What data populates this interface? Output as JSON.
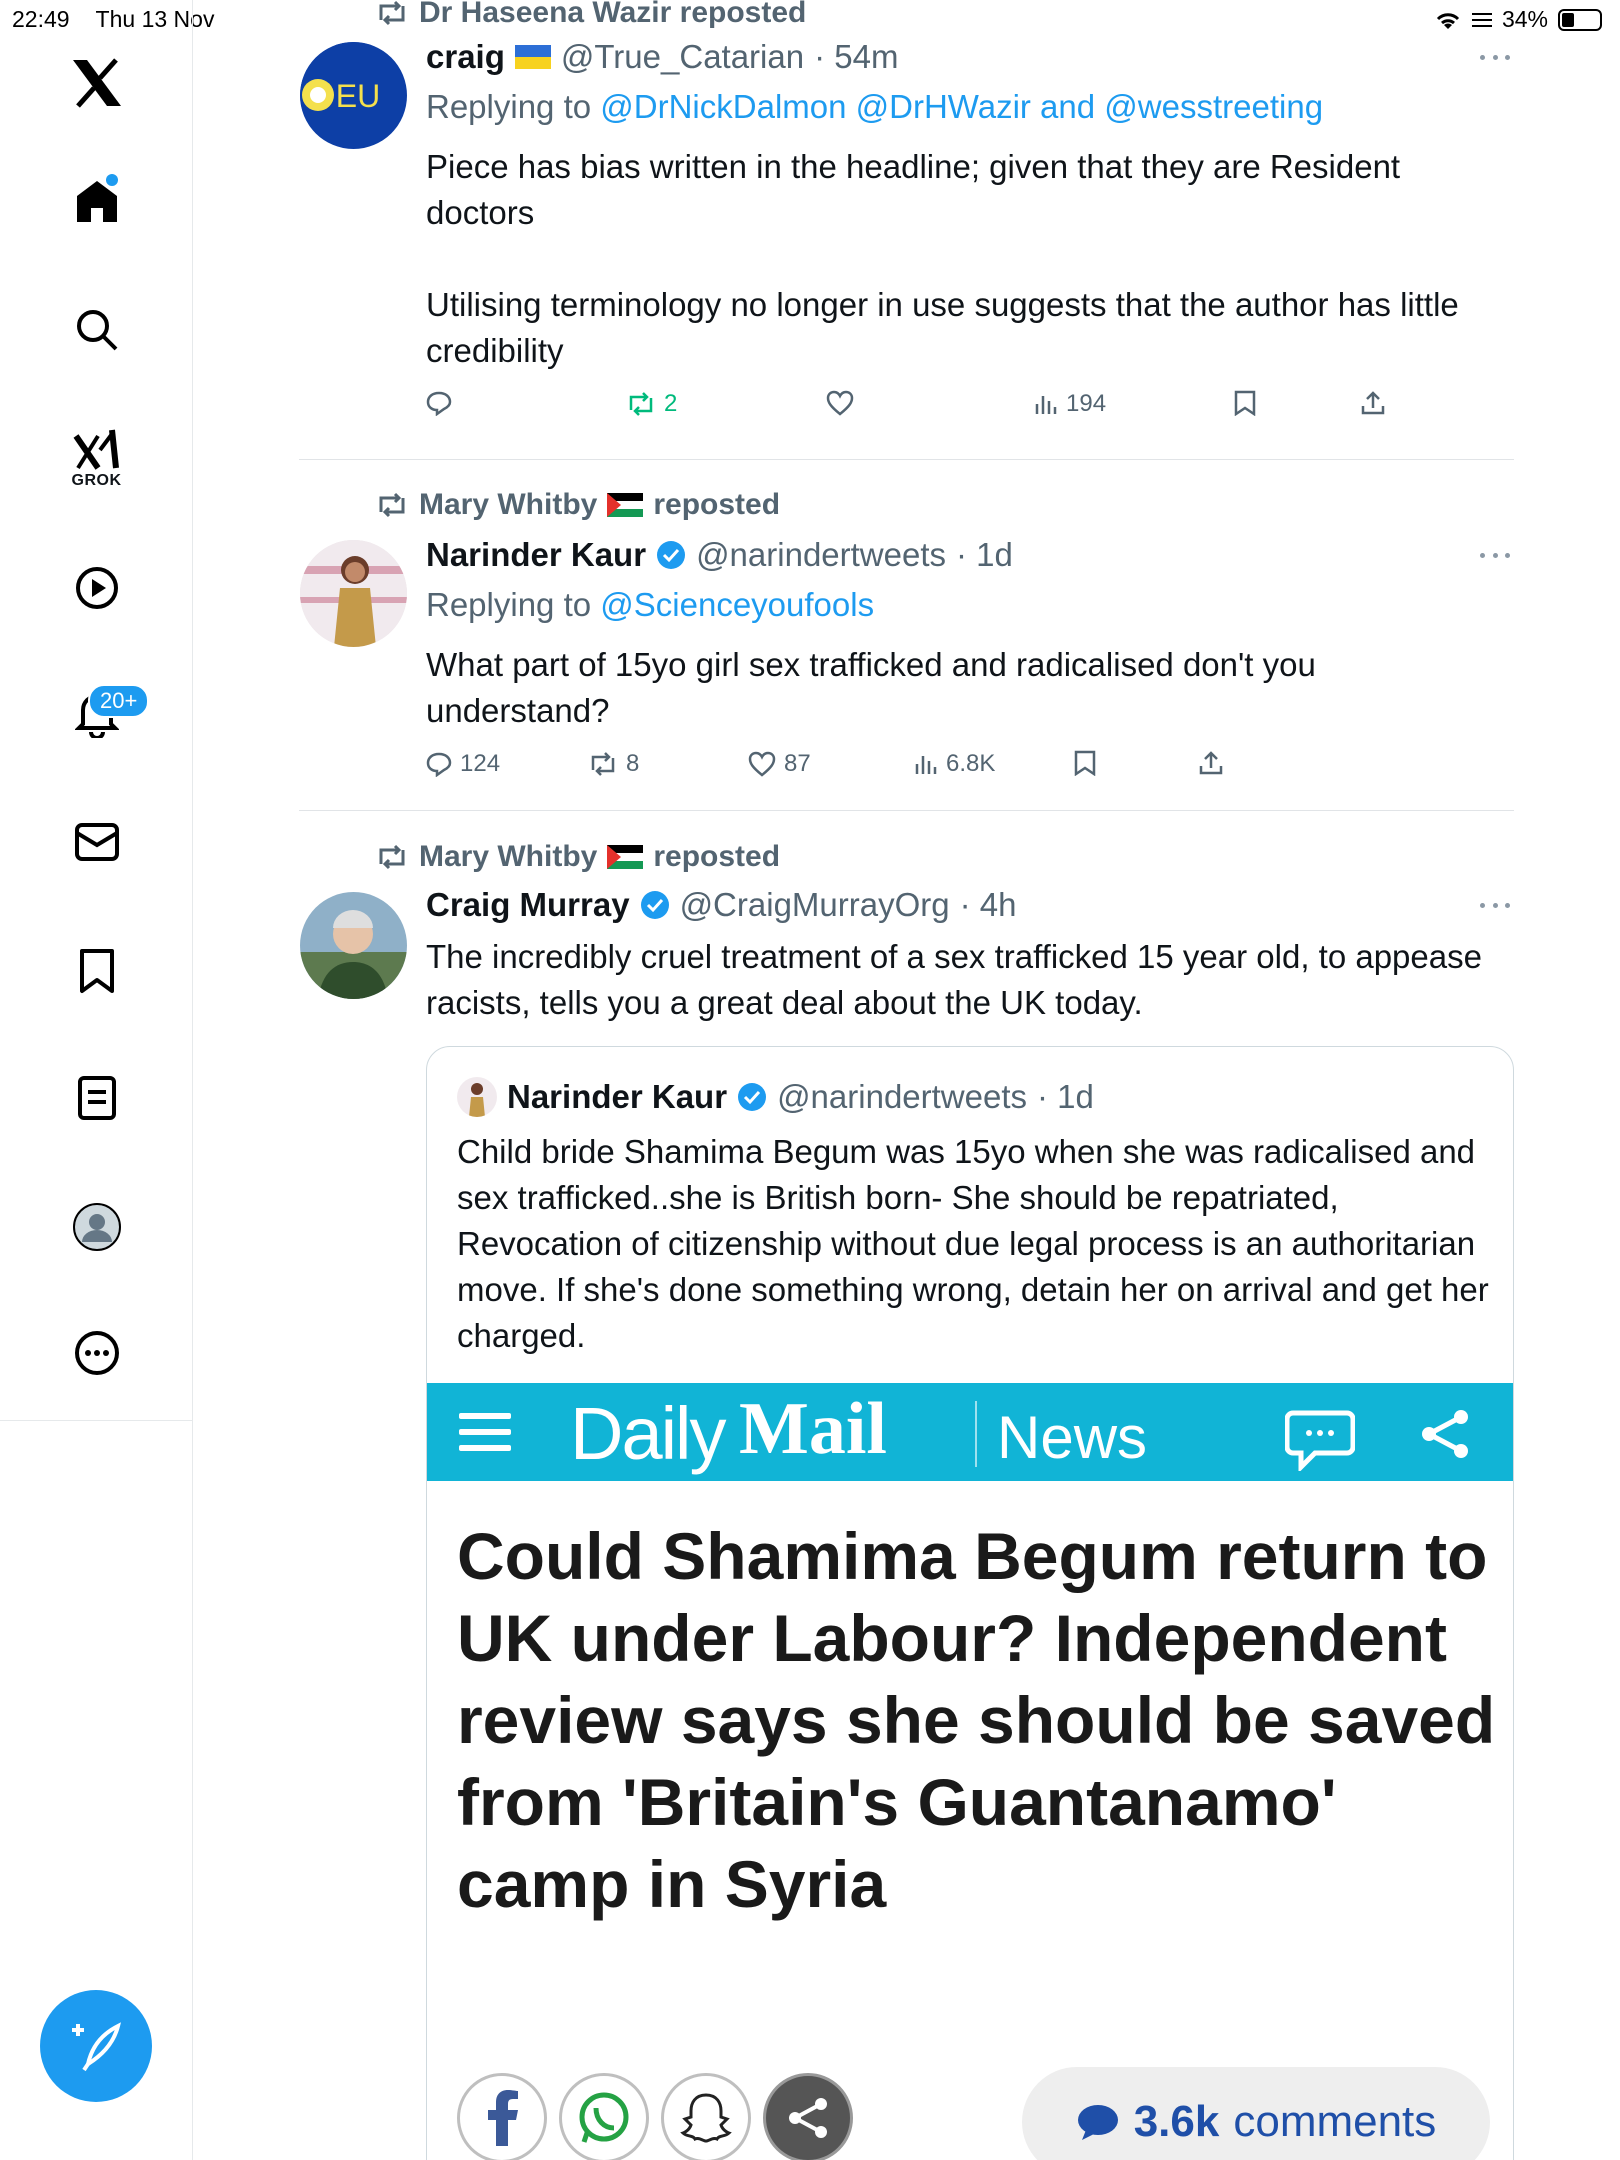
{
  "status_bar": {
    "time": "22:49",
    "date": "Thu 13 Nov",
    "battery": "34%"
  },
  "sidebar": {
    "grok_label": "GROK",
    "notifications_badge": "20+"
  },
  "tweets": [
    {
      "repost_by": "Dr Haseena Wazir reposted",
      "name": "craig",
      "handle": "@True_Catarian",
      "time": "· 54m",
      "replying_prefix": "Replying to",
      "replying_to": "@DrNickDalmon @DrHWazir and @wesstreeting",
      "text_p1": "Piece has bias written in the headline; given that they are Resident doctors",
      "text_p2": "Utilising terminology no longer in use suggests that the author has little credibility",
      "retweets": "2",
      "views": "194"
    },
    {
      "repost_by": "Mary Whitby",
      "repost_suffix": "reposted",
      "name": "Narinder Kaur",
      "handle": "@narindertweets",
      "time": "· 1d",
      "replying_prefix": "Replying to",
      "replying_to": "@Scienceyoufools",
      "text": "What part of 15yo girl sex trafficked and radicalised don't you understand?",
      "replies": "124",
      "retweets": "8",
      "likes": "87",
      "views": "6.8K"
    },
    {
      "repost_by": "Mary Whitby",
      "repost_suffix": "reposted",
      "name": "Craig Murray",
      "handle": "@CraigMurrayOrg",
      "time": "· 4h",
      "text": "The incredibly cruel treatment of a sex trafficked 15 year old, to appease racists, tells you a great deal about the UK today.",
      "quote": {
        "name": "Narinder Kaur",
        "handle": "@narindertweets",
        "time": "· 1d",
        "text": "Child bride Shamima Begum was 15yo when she was radicalised and sex trafficked..she is British born-  She should be repatriated, Revocation of citizenship without due legal process is an authoritarian move. If she's done something wrong, detain her on arrival and get her charged.",
        "image": {
          "brand_daily": "Daily",
          "brand_mail": "Mail",
          "section": "News",
          "headline": "Could Shamima Begum return to UK under Labour? Independent review says she should be saved from 'Britain's Guantanamo' camp in Syria",
          "comments_count": "3.6k",
          "comments_label": "comments"
        }
      }
    }
  ],
  "colors": {
    "accent": "#1d9bf0",
    "retweet_green": "#00ba7c",
    "muted": "#536471",
    "daily_mail_blue": "#11b4d6"
  },
  "icons": [
    "x-logo-icon",
    "home-icon",
    "search-icon",
    "grok-icon",
    "video-icon",
    "bell-icon",
    "mail-icon",
    "bookmark-icon",
    "list-icon",
    "profile-icon",
    "more-icon",
    "compose-icon",
    "retweet-icon",
    "reply-icon",
    "like-icon",
    "views-icon",
    "share-icon",
    "verified-icon",
    "palestine-flag-icon",
    "ukraine-flag-icon"
  ]
}
